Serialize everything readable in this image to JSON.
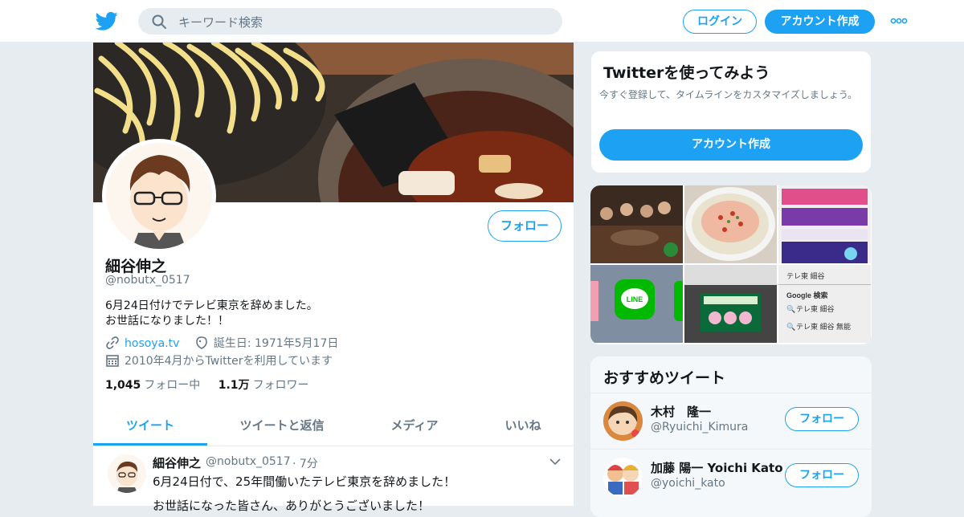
{
  "topbar": {
    "search_placeholder": "キーワード検索",
    "login_label": "ログイン",
    "signup_label": "アカウント作成"
  },
  "profile": {
    "follow_label": "フォロー",
    "name": "細谷伸之",
    "handle": "@nobutx_0517",
    "bio_line1": "6月24日付けでテレビ東京を辞めました。",
    "bio_line2": "お世話になりました！！",
    "website": "hosoya.tv",
    "birthday": "誕生日: 1971年5月17日",
    "joined": "2010年4月からTwitterを利用しています",
    "following_count": "1,045",
    "following_label": "フォロー中",
    "followers_count": "1.1万",
    "followers_label": "フォロワー"
  },
  "tabs": [
    {
      "label": "ツイート",
      "active": true
    },
    {
      "label": "ツイートと返信",
      "active": false
    },
    {
      "label": "メディア",
      "active": false
    },
    {
      "label": "いいね",
      "active": false
    }
  ],
  "tweet": {
    "name": "細谷伸之",
    "handle": "@nobutx_0517",
    "time": "· 7分",
    "text": "6月24日付で、25年間働いたテレビ東京を辞めました！",
    "text_partial": "お世話になった皆さん、ありがとうございました！"
  },
  "signup_card": {
    "title": "Twitterを使ってみよう",
    "description": "今すぐ登録して、タイムラインをカスタマイズしましょう。",
    "button_label": "アカウント作成"
  },
  "media_tiles": {
    "line_label": "LINE",
    "search_title": "テレ東 細谷",
    "google_label": "Google 検索",
    "result1": "テレ東 細谷",
    "result2": "テレ東 細谷 無能"
  },
  "recommendations": {
    "title": "おすすめツイート",
    "items": [
      {
        "name": "木村　隆一",
        "handle": "@Ryuichi_Kimura",
        "follow_label": "フォロー"
      },
      {
        "name": "加藤 陽一 Yoichi Kato",
        "handle": "@yoichi_kato",
        "follow_label": "フォロー"
      }
    ]
  },
  "colors": {
    "accent": "#1da1f2",
    "background": "#e6ecf0",
    "secondary_text": "#657786"
  },
  "icons": [
    "twitter-bird-icon",
    "search-icon",
    "more-dots-icon",
    "link-icon",
    "birthday-icon",
    "calendar-icon",
    "chevron-down-icon"
  ]
}
